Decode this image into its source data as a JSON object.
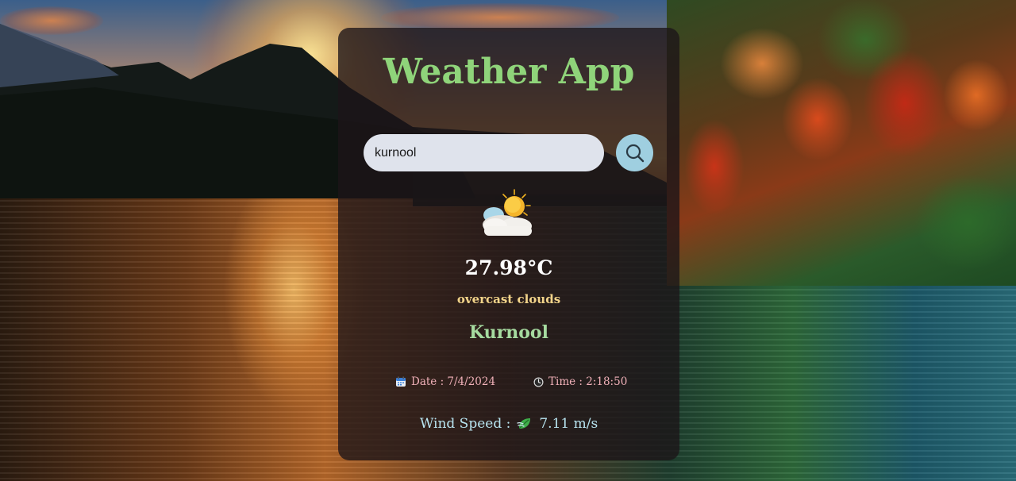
{
  "app": {
    "title": "Weather App"
  },
  "search": {
    "value": "kurnool",
    "icon": "search-icon"
  },
  "weather": {
    "icon": "partly-cloudy-sun-icon",
    "temperature": "27.98°C",
    "description": "overcast clouds",
    "city": "Kurnool"
  },
  "details": {
    "date_label": "Date : 7/4/2024",
    "date_icon": "calendar-icon",
    "time_label": "Time : 2:18:50",
    "time_icon": "clock-icon",
    "wind_label": "Wind Speed :",
    "wind_icon": "wind-leaf-icon",
    "wind_value": "7.11 m/s"
  },
  "colors": {
    "title": "#8fd47a",
    "description": "#f2d48a",
    "city": "#a6dba0",
    "date_time": "#f0b0b8",
    "wind": "#b8e4f0",
    "search_button": "#9fcfe0"
  }
}
